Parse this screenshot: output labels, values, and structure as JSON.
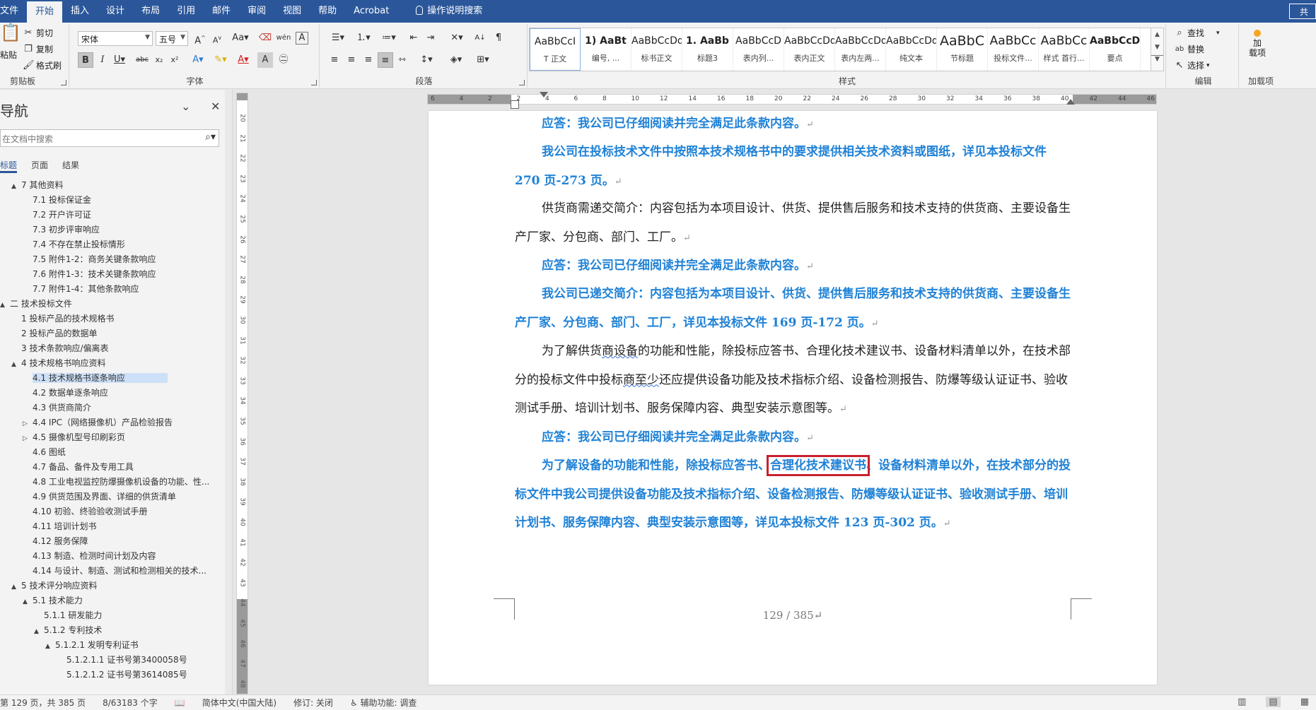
{
  "tabs": [
    "文件",
    "开始",
    "插入",
    "设计",
    "布局",
    "引用",
    "邮件",
    "审阅",
    "视图",
    "帮助",
    "Acrobat"
  ],
  "active_tab": "开始",
  "tell_me": "操作说明搜索",
  "share": "共",
  "clipboard": {
    "paste": "粘贴",
    "cut": "剪切",
    "copy": "复制",
    "format_painter": "格式刷",
    "label": "剪贴板"
  },
  "font": {
    "name": "宋体",
    "size": "五号",
    "label": "字体"
  },
  "paragraph": {
    "label": "段落"
  },
  "styles": {
    "label": "样式",
    "items": [
      {
        "sample": "AaBbCcI",
        "name": "T 正文"
      },
      {
        "sample": "1) AaBt",
        "name": "编号, ..."
      },
      {
        "sample": "AaBbCcDdI",
        "name": "标书正文"
      },
      {
        "sample": "1. AaBb",
        "name": "标题3"
      },
      {
        "sample": "AaBbCcD",
        "name": "表内列..."
      },
      {
        "sample": "AaBbCcDdI",
        "name": "表内正文"
      },
      {
        "sample": "AaBbCcDdEe",
        "name": "表内左两..."
      },
      {
        "sample": "AaBbCcDdI",
        "name": "纯文本"
      },
      {
        "sample": "AaBbC",
        "name": "节标题"
      },
      {
        "sample": "AaBbCc",
        "name": "投标文件..."
      },
      {
        "sample": "AaBbCc",
        "name": "样式 首行..."
      },
      {
        "sample": "AaBbCcD",
        "name": "要点"
      }
    ]
  },
  "editing": {
    "find": "查找",
    "replace": "替换",
    "select": "选择",
    "label": "编辑"
  },
  "addins": {
    "button": "加\n载项",
    "label": "加载项"
  },
  "nav": {
    "title": "导航",
    "search_placeholder": "在文档中搜索",
    "tabs": [
      "标题",
      "页面",
      "结果"
    ],
    "tree": [
      {
        "level": 1,
        "toggle": "▲",
        "text": "7 其他资料"
      },
      {
        "level": 2,
        "toggle": "",
        "text": "7.1 投标保证金"
      },
      {
        "level": 2,
        "toggle": "",
        "text": "7.2 开户许可证"
      },
      {
        "level": 2,
        "toggle": "",
        "text": "7.3 初步评审响应"
      },
      {
        "level": 2,
        "toggle": "",
        "text": "7.4 不存在禁止投标情形"
      },
      {
        "level": 2,
        "toggle": "",
        "text": "7.5 附件1-2：商务关键条款响应"
      },
      {
        "level": 2,
        "toggle": "",
        "text": "7.6 附件1-3：技术关键条款响应"
      },
      {
        "level": 2,
        "toggle": "",
        "text": "7.7 附件1-4：其他条款响应"
      },
      {
        "level": 0,
        "toggle": "▲",
        "text": "二 技术投标文件"
      },
      {
        "level": 1,
        "toggle": "",
        "text": "1 投标产品的技术规格书"
      },
      {
        "level": 1,
        "toggle": "",
        "text": "2 投标产品的数据单"
      },
      {
        "level": 1,
        "toggle": "",
        "text": "3 技术条款响应/偏离表"
      },
      {
        "level": 1,
        "toggle": "▲",
        "text": "4 技术规格书响应资料"
      },
      {
        "level": 2,
        "toggle": "",
        "text": "4.1 技术规格书逐条响应",
        "selected": true
      },
      {
        "level": 2,
        "toggle": "",
        "text": "4.2 数据单逐条响应"
      },
      {
        "level": 2,
        "toggle": "",
        "text": "4.3 供货商简介"
      },
      {
        "level": 2,
        "toggle": "▷",
        "text": "4.4 IPC（网络摄像机）产品检验报告"
      },
      {
        "level": 2,
        "toggle": "▷",
        "text": "4.5 摄像机型号印刷彩页"
      },
      {
        "level": 2,
        "toggle": "",
        "text": "4.6 图纸"
      },
      {
        "level": 2,
        "toggle": "",
        "text": "4.7 备品、备件及专用工具"
      },
      {
        "level": 2,
        "toggle": "",
        "text": "4.8 工业电视监控防爆摄像机设备的功能、性..."
      },
      {
        "level": 2,
        "toggle": "",
        "text": "4.9 供货范围及界面、详细的供货清单"
      },
      {
        "level": 2,
        "toggle": "",
        "text": "4.10 初验、终验验收测试手册"
      },
      {
        "level": 2,
        "toggle": "",
        "text": "4.11 培训计划书"
      },
      {
        "level": 2,
        "toggle": "",
        "text": "4.12 服务保障"
      },
      {
        "level": 2,
        "toggle": "",
        "text": "4.13 制造、检测时间计划及内容"
      },
      {
        "level": 2,
        "toggle": "",
        "text": "4.14 与设计、制造、测试和检测相关的技术..."
      },
      {
        "level": 1,
        "toggle": "▲",
        "text": "5 技术评分响应资料"
      },
      {
        "level": 2,
        "toggle": "▲",
        "text": "5.1 技术能力"
      },
      {
        "level": 3,
        "toggle": "",
        "text": "5.1.1 研发能力"
      },
      {
        "level": 3,
        "toggle": "▲",
        "text": "5.1.2 专利技术"
      },
      {
        "level": 4,
        "toggle": "▲",
        "text": "5.1.2.1 发明专利证书"
      },
      {
        "level": 5,
        "toggle": "",
        "text": "5.1.2.1.1 证书号第3400058号"
      },
      {
        "level": 5,
        "toggle": "",
        "text": "5.1.2.1.2 证书号第3614085号"
      }
    ]
  },
  "ruler": {
    "h_labels": [
      "6",
      "4",
      "2",
      "2",
      "4",
      "6",
      "8",
      "10",
      "12",
      "14",
      "16",
      "18",
      "20",
      "22",
      "24",
      "26",
      "28",
      "30",
      "32",
      "34",
      "36",
      "38",
      "40",
      "42",
      "44",
      "46"
    ],
    "v_labels": [
      "20",
      "21",
      "22",
      "23",
      "24",
      "25",
      "26",
      "27",
      "28",
      "29",
      "30",
      "31",
      "32",
      "33",
      "34",
      "35",
      "36",
      "37",
      "38",
      "39",
      "40",
      "41",
      "42",
      "43",
      "44",
      "45",
      "46",
      "47",
      "48",
      "49"
    ]
  },
  "document": {
    "p1": "应答：我公司已仔细阅读并完全满足此条款内容。",
    "p2": "我公司在投标技术文件中按照本技术规格书中的要求提供相关技术资料或图纸，详见本投标文件 270 页-273 页。",
    "p3": "供货商需递交简介：内容包括为本项目设计、供货、提供售后服务和技术支持的供货商、主要设备生产厂家、分包商、部门、工厂。",
    "p4": "应答：我公司已仔细阅读并完全满足此条款内容。",
    "p5": "我公司已递交简介：内容包括为本项目设计、供货、提供售后服务和技术支持的供货商、主要设备生产厂家、分包商、部门、工厂，详见本投标文件 169 页-172 页。",
    "p6a": "为了解供货",
    "p6b": "商设备",
    "p6c": "的功能和性能，除投标应答书、合理化技术建议书、设备材料清单以外，在技术部分的投标文件中投标",
    "p6d": "商至少",
    "p6e": "还应提供设备功能及技术指标介绍、设备检测报告、防爆等级认证证书、验收测试手册、培训计划书、服务保障内容、典型安装示意图等。",
    "p7": "应答：我公司已仔细阅读并完全满足此条款内容。",
    "p8a": "为了解设备的功能和性能，除投标应答书、",
    "p8b": "合理化技术建议书",
    "p8c": "、设备材料清单以外，在技术部分的投标文件中我公司提供设备功能及技术指标介绍、设备检测报告、防爆等级认证证书、验收测试手册、培训计划书、服务保障内容、典型安装示意图等，详见本投标文件 123 页-302 页。",
    "para_mark": "↵",
    "page_number": "129 / 385↵"
  },
  "status": {
    "page": "第 129 页，共 385 页",
    "words": "8/63183 个字",
    "language": "简体中文(中国大陆)",
    "track": "修订: 关闭",
    "accessibility": "辅助功能: 调查"
  },
  "colors": {
    "accent": "#2b579a",
    "answer_blue": "#2082d6",
    "highlight_box": "#c9202e"
  }
}
